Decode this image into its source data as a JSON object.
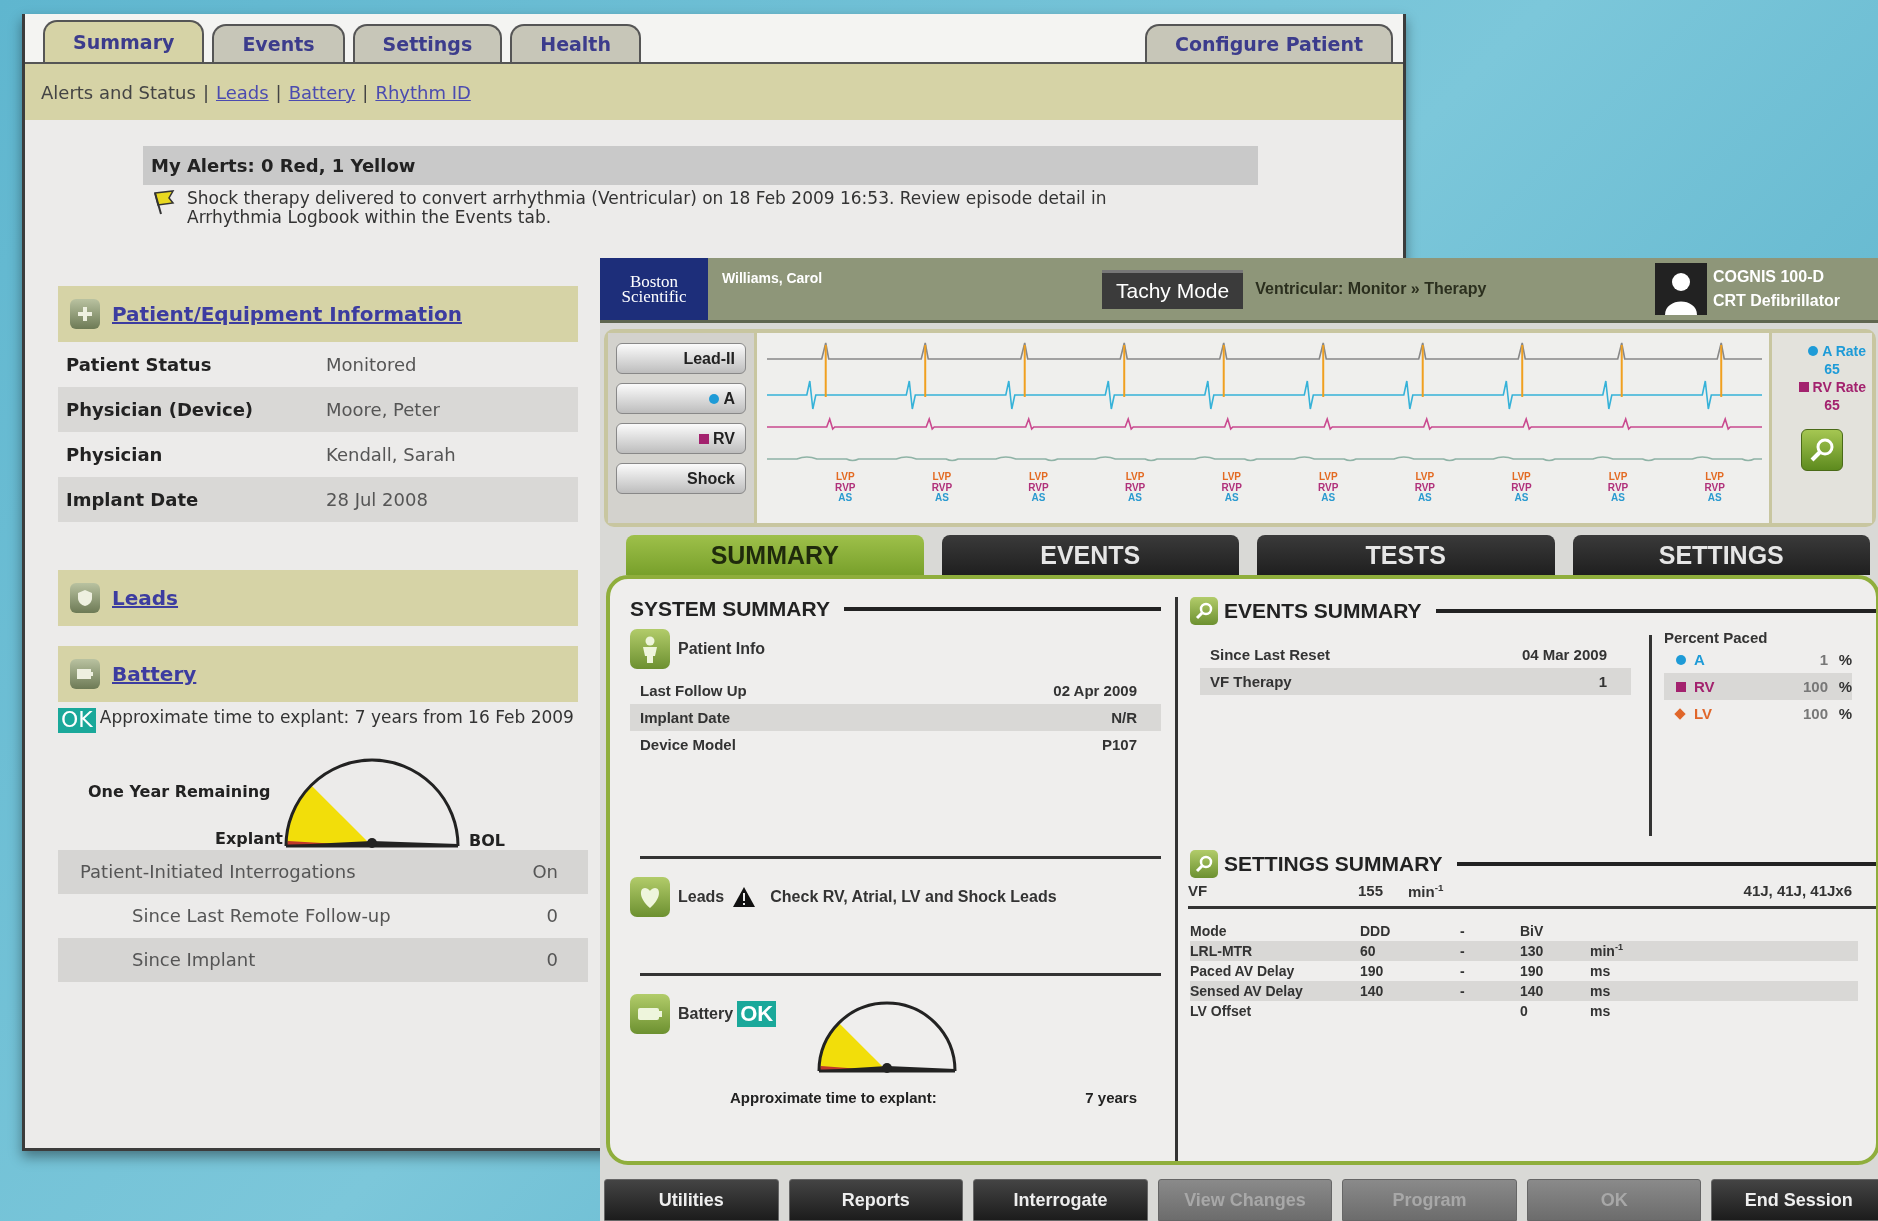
{
  "back_window": {
    "tabs": [
      {
        "label": "Summary",
        "selected": true
      },
      {
        "label": "Events",
        "selected": false
      },
      {
        "label": "Settings",
        "selected": false
      },
      {
        "label": "Health",
        "selected": false
      }
    ],
    "configure_button": "Configure Patient",
    "subnav_separator": "|",
    "subnav": [
      {
        "label": "Alerts and Status",
        "kind": "text"
      },
      {
        "label": "Leads",
        "kind": "link"
      },
      {
        "label": "Battery",
        "kind": "link"
      },
      {
        "label": "Rhythm ID",
        "kind": "link"
      }
    ],
    "alerts": {
      "title": "My Alerts: 0 Red, 1 Yellow",
      "message": "Shock therapy delivered to convert arrhythmia (Ventricular) on 18 Feb 2009 16:53. Review episode detail in Arrhythmia Logbook within the Events tab."
    },
    "sections": [
      {
        "title": "Patient/Equipment Information",
        "kind": "info",
        "rows": [
          {
            "label": "Patient Status",
            "value": "Monitored"
          },
          {
            "label": "Physician (Device)",
            "value": "Moore, Peter"
          },
          {
            "label": "Physician",
            "value": "Kendall, Sarah"
          },
          {
            "label": "Implant Date",
            "value": "28 Jul 2008"
          }
        ]
      },
      {
        "title": "Leads",
        "kind": "leads"
      },
      {
        "title": "Battery",
        "kind": "battery"
      }
    ],
    "battery": {
      "status": "OK",
      "text": "Approximate time to explant: 7 years from 16 Feb 2009",
      "remaining_label": "One Year Remaining",
      "explant_label": "Explant",
      "bol_label": "BOL"
    },
    "interrogations": [
      {
        "label": "Patient-Initiated Interrogations",
        "value": "On",
        "children": [
          {
            "label": "Since Last Remote Follow-up",
            "value": "0"
          },
          {
            "label": "Since Implant",
            "value": "0"
          }
        ]
      }
    ]
  },
  "front_window": {
    "logo": "Boston Scientific",
    "patient": "Williams, Carol",
    "mode": "Tachy Mode",
    "mode_status": "Ventricular: Monitor » Therapy",
    "device": [
      "COGNIS 100-D",
      "CRT Defibrillator"
    ],
    "channels": [
      {
        "label": "Lead-II"
      },
      {
        "label": "A",
        "kind": "dot",
        "color": "#1e9bd7"
      },
      {
        "label": "RV",
        "kind": "square",
        "color": "#a3226e"
      },
      {
        "label": "Shock"
      }
    ],
    "markers": [
      [
        "LVP",
        "RVP",
        "AS"
      ],
      [
        "LVP",
        "RVP",
        "AS"
      ],
      [
        "LVP",
        "RVP",
        "AS"
      ],
      [
        "LVP",
        "RVP",
        "AS"
      ],
      [
        "LVP",
        "RVP",
        "AS"
      ],
      [
        "LVP",
        "RVP",
        "AS"
      ],
      [
        "LVP",
        "RVP",
        "AS"
      ],
      [
        "LVP",
        "RVP",
        "AS"
      ],
      [
        "LVP",
        "RVP",
        "AS"
      ],
      [
        "LVP",
        "RVP",
        "AS"
      ]
    ],
    "rates": [
      {
        "label": "A Rate",
        "value": "65",
        "kind": "dot",
        "color": "#1e9bd7"
      },
      {
        "label": "RV Rate",
        "value": "65",
        "kind": "square",
        "color": "#a3226e"
      }
    ],
    "tabs": [
      {
        "label": "SUMMARY",
        "selected": true
      },
      {
        "label": "EVENTS",
        "selected": false
      },
      {
        "label": "TESTS",
        "selected": false
      },
      {
        "label": "SETTINGS",
        "selected": false
      }
    ],
    "system_summary": {
      "title": "SYSTEM SUMMARY",
      "patient_info": {
        "title": "Patient Info",
        "rows": [
          {
            "label": "Last Follow Up",
            "value": "02 Apr 2009"
          },
          {
            "label": "Implant Date",
            "value": "N/R"
          },
          {
            "label": "Device Model",
            "value": "P107"
          }
        ]
      },
      "leads": {
        "title": "Leads",
        "warning": "Check RV, Atrial, LV and Shock Leads"
      },
      "battery": {
        "title": "Battery",
        "status": "OK",
        "explant_label": "Approximate time to explant:",
        "explant_value": "7 years"
      }
    },
    "events_summary": {
      "title": "EVENTS SUMMARY",
      "rows": [
        {
          "label": "Since Last Reset",
          "value": "04 Mar 2009"
        },
        {
          "label": "VF Therapy",
          "value": "1"
        }
      ],
      "percent_paced": {
        "title": "Percent Paced",
        "rows": [
          {
            "label": "A",
            "value": "1",
            "unit": "%",
            "kind": "dot",
            "color": "#1e9bd7"
          },
          {
            "label": "RV",
            "value": "100",
            "unit": "%",
            "kind": "square",
            "color": "#a3226e"
          },
          {
            "label": "LV",
            "value": "100",
            "unit": "%",
            "kind": "diamond",
            "color": "#e0662a"
          }
        ]
      }
    },
    "settings_summary": {
      "title": "SETTINGS SUMMARY",
      "vf": {
        "label": "VF",
        "value": "155",
        "unit": "min$^{-1}$",
        "energy": "41J, 41J, 41Jx6"
      },
      "rows": [
        {
          "label": "Mode",
          "low": "DDD",
          "dash": "-",
          "high": "BiV"
        },
        {
          "label": "LRL-MTR",
          "low": "60",
          "dash": "-",
          "high": "130",
          "unit": "min$^{-1}$"
        },
        {
          "label": "Paced AV Delay",
          "low": "190",
          "dash": "-",
          "high": "190",
          "unit": "ms"
        },
        {
          "label": "Sensed AV Delay",
          "low": "140",
          "dash": "-",
          "high": "140",
          "unit": "ms"
        },
        {
          "label": "LV Offset",
          "high": "0",
          "unit": "ms"
        }
      ]
    },
    "buttons": [
      {
        "label": "Utilities",
        "disabled": false
      },
      {
        "label": "Reports",
        "disabled": false
      },
      {
        "label": "Interrogate",
        "disabled": false
      },
      {
        "label": "View Changes",
        "disabled": true
      },
      {
        "label": "Program",
        "disabled": true
      },
      {
        "label": "OK",
        "disabled": true
      },
      {
        "label": "End Session",
        "disabled": false
      }
    ]
  }
}
